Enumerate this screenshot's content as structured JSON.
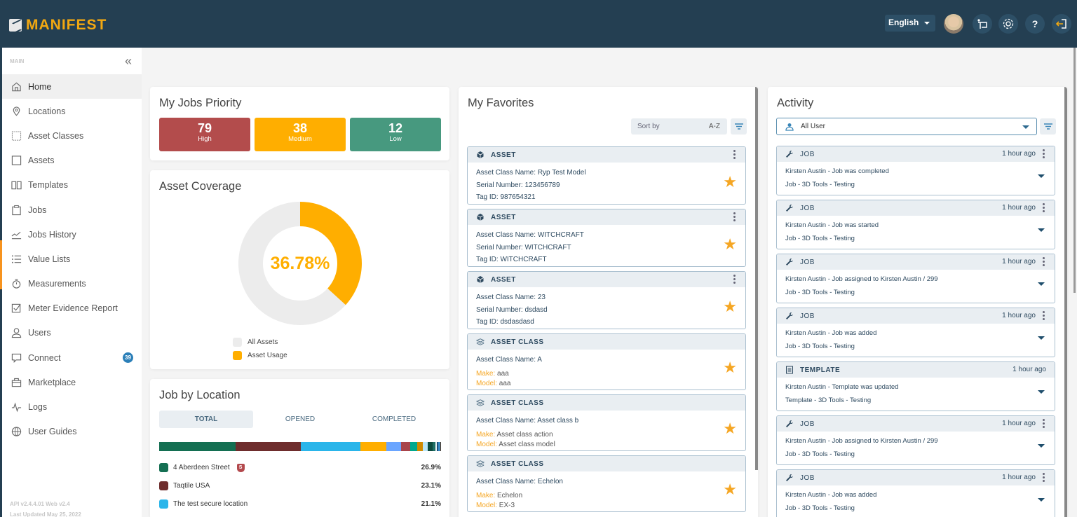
{
  "app": {
    "brand": "MANIFEST"
  },
  "topbar": {
    "language": "English",
    "icons": [
      "avatar",
      "presentation-icon",
      "gear-icon",
      "help-icon",
      "logout-icon"
    ],
    "help_label": "?"
  },
  "sidebar": {
    "section": "MAIN",
    "collapse_glyph": "«",
    "items": [
      {
        "label": "Home",
        "icon": "home-icon",
        "active": true
      },
      {
        "label": "Locations",
        "icon": "location-pin-icon"
      },
      {
        "label": "Asset Classes",
        "icon": "dashed-square-icon"
      },
      {
        "label": "Assets",
        "icon": "square-icon"
      },
      {
        "label": "Templates",
        "icon": "book-icon"
      },
      {
        "label": "Jobs",
        "icon": "clipboard-icon"
      },
      {
        "label": "Jobs History",
        "icon": "trend-icon"
      },
      {
        "label": "Value Lists",
        "icon": "list-icon"
      },
      {
        "label": "Measurements",
        "icon": "stopwatch-icon"
      },
      {
        "label": "Meter Evidence Report",
        "icon": "checkbox-icon"
      },
      {
        "label": "Users",
        "icon": "user-icon"
      },
      {
        "label": "Connect",
        "icon": "chat-icon",
        "badge": "39"
      },
      {
        "label": "Marketplace",
        "icon": "briefcase-icon"
      },
      {
        "label": "Logs",
        "icon": "pulse-icon"
      },
      {
        "label": "User Guides",
        "icon": "globe-icon"
      }
    ],
    "footer": {
      "version": "API v2.4.4.01 Web v2.4",
      "updated": "Last Updated May 25, 2022"
    }
  },
  "jobs_priority": {
    "title": "My Jobs Priority",
    "items": [
      {
        "count": "79",
        "label": "High",
        "color": "#b34c4c"
      },
      {
        "count": "38",
        "label": "Medium",
        "color": "#ffae00"
      },
      {
        "count": "12",
        "label": "Low",
        "color": "#47997f"
      }
    ]
  },
  "asset_coverage": {
    "title": "Asset Coverage",
    "percent_label": "36.78%",
    "legend": [
      {
        "label": "All Assets",
        "color": "#ececec"
      },
      {
        "label": "Asset Usage",
        "color": "#ffae00"
      }
    ]
  },
  "job_by_location": {
    "title": "Job by Location",
    "tabs": [
      {
        "label": "TOTAL",
        "active": true
      },
      {
        "label": "OPENED"
      },
      {
        "label": "COMPLETED"
      }
    ],
    "rows": [
      {
        "name": "4 Aberdeen Street",
        "percent": "26.9%",
        "color": "#146f52",
        "secure": true,
        "secure_label": "S"
      },
      {
        "name": "Taqtile USA",
        "percent": "23.1%",
        "color": "#6e2d2d"
      },
      {
        "name": "The test secure location",
        "percent": "21.1%",
        "color": "#2ab5ea"
      }
    ]
  },
  "chart_data": {
    "type": "pie",
    "title": "Asset Coverage",
    "categories": [
      "Asset Usage",
      "All Assets (remaining)"
    ],
    "values": [
      36.78,
      63.22
    ],
    "center_label": "36.78%",
    "legend": [
      "All Assets",
      "Asset Usage"
    ],
    "legend_position": "bottom",
    "stacked_location_bar": {
      "type": "bar",
      "title": "Job by Location",
      "series": [
        {
          "name": "4 Aberdeen Street",
          "value": 26.9,
          "color": "#146f52"
        },
        {
          "name": "Taqtile USA",
          "value": 23.1,
          "color": "#6e2d2d"
        },
        {
          "name": "The test secure location",
          "value": 21.1,
          "color": "#2ab5ea"
        },
        {
          "name": "",
          "value": 9.2,
          "color": "#ffae00"
        },
        {
          "name": "",
          "value": 5.0,
          "color": "#6aa5ff"
        },
        {
          "name": "",
          "value": 3.2,
          "color": "#a8444a"
        },
        {
          "name": "",
          "value": 2.6,
          "color": "#00a88e"
        },
        {
          "name": "",
          "value": 2.0,
          "color": "#d08a00"
        },
        {
          "name": "",
          "value": 1.7,
          "color": "#b9e5f7"
        },
        {
          "name": "",
          "value": 1.7,
          "color": "#0d4a3d"
        },
        {
          "name": "",
          "value": 1.0,
          "color": "#1f6e64"
        },
        {
          "name": "",
          "value": 0.5,
          "color": "#e9f4f6"
        },
        {
          "name": "",
          "value": 0.6,
          "color": "#1b4e7a"
        },
        {
          "name": "",
          "value": 0.6,
          "color": "#3a8ac4"
        },
        {
          "name": "",
          "value": 0.3,
          "color": "#5a3a20"
        }
      ]
    }
  },
  "favorites": {
    "title": "My Favorites",
    "sort_label": "Sort by",
    "sort_value": "A-Z",
    "items": [
      {
        "type": "ASSET",
        "lines": [
          [
            "Asset Class Name: ",
            "Ryp Test Model"
          ],
          [
            "Serial Number: ",
            "123456789"
          ],
          [
            "Tag ID: ",
            "987654321"
          ]
        ]
      },
      {
        "type": "ASSET",
        "lines": [
          [
            "Asset Class Name: ",
            "WITCHCRAFT"
          ],
          [
            "Serial Number: ",
            "WITCHCRAFT"
          ],
          [
            "Tag ID: ",
            "WITCHCRAFT"
          ]
        ]
      },
      {
        "type": "ASSET",
        "lines": [
          [
            "Asset Class Name: ",
            "23"
          ],
          [
            "Serial Number: ",
            "dsdasd"
          ],
          [
            "Tag ID: ",
            "dsdasdasd"
          ]
        ]
      },
      {
        "type": "ASSET CLASS",
        "name": [
          "Asset Class Name: ",
          "A"
        ],
        "make": [
          "Make: ",
          "aaa"
        ],
        "model": [
          "Model: ",
          "aaa"
        ]
      },
      {
        "type": "ASSET CLASS",
        "name": [
          "Asset Class Name: ",
          "Asset class b"
        ],
        "make": [
          "Make: ",
          "Asset class action"
        ],
        "model": [
          "Model: ",
          "Asset class model"
        ]
      },
      {
        "type": "ASSET CLASS",
        "name": [
          "Asset Class Name: ",
          "Echelon"
        ],
        "make": [
          "Make: ",
          "Echelon"
        ],
        "model": [
          "Model: ",
          "EX-3"
        ]
      }
    ]
  },
  "activity": {
    "title": "Activity",
    "user_filter": "All User",
    "items": [
      {
        "type": "JOB",
        "time": "1 hour ago",
        "line1": "Kirsten Austin - Job was completed",
        "line2": "Job - 3D Tools - Testing",
        "menu": true
      },
      {
        "type": "JOB",
        "time": "1 hour ago",
        "line1": "Kirsten Austin - Job was started",
        "line2": "Job - 3D Tools - Testing",
        "menu": true
      },
      {
        "type": "JOB",
        "time": "1 hour ago",
        "line1": "Kirsten Austin - Job assigned to Kirsten Austin / 299",
        "line2": "Job - 3D Tools - Testing",
        "menu": true
      },
      {
        "type": "JOB",
        "time": "1 hour ago",
        "line1": "Kirsten Austin - Job was added",
        "line2": "Job - 3D Tools - Testing",
        "menu": true
      },
      {
        "type": "TEMPLATE",
        "time": "1 hour ago",
        "line1": "Kirsten Austin - Template was updated",
        "line2": "Template - 3D Tools - Testing",
        "menu": false
      },
      {
        "type": "JOB",
        "time": "1 hour ago",
        "line1": "Kirsten Austin - Job assigned to Kirsten Austin / 299",
        "line2": "Job - 3D Tools - Testing",
        "menu": true
      },
      {
        "type": "JOB",
        "time": "1 hour ago",
        "line1": "Kirsten Austin - Job was added",
        "line2": "Job - 3D Tools - Testing",
        "menu": true
      }
    ]
  }
}
